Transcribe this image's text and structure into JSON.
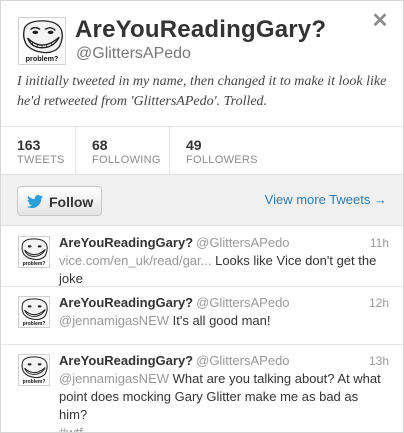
{
  "profile": {
    "name": "AreYouReadingGary?",
    "handle": "@GlittersAPedo",
    "bio": "I initially tweeted in my name, then changed it to make it look like he'd retweeted from 'GlittersAPedo'. Trolled.",
    "avatar_caption": "problem?",
    "close_icon": "close-icon"
  },
  "stats": [
    {
      "value": "163",
      "label": "TWEETS"
    },
    {
      "value": "68",
      "label": "FOLLOWING"
    },
    {
      "value": "49",
      "label": "FOLLOWERS"
    }
  ],
  "actions": {
    "follow_label": "Follow",
    "more_tweets_label": "View more Tweets →"
  },
  "tweets": [
    {
      "name": "AreYouReadingGary?",
      "handle": "@GlittersAPedo",
      "time": "11h",
      "link": "vice.com/en_uk/read/gar...",
      "text": " Looks like Vice don't get the joke"
    },
    {
      "name": "AreYouReadingGary?",
      "handle": "@GlittersAPedo",
      "time": "12h",
      "mention": "@jennamigasNEW",
      "text": " It's all good man!"
    },
    {
      "name": "AreYouReadingGary?",
      "handle": "@GlittersAPedo",
      "time": "13h",
      "mention": "@jennamigasNEW",
      "text": " What are you talking about? At what point does mocking Gary Glitter make me as bad as him?",
      "hashtag": "#wtf"
    }
  ],
  "colors": {
    "link_blue": "#2b7bb9",
    "muted_gray": "#999999",
    "bar_bg": "#f0f0f0"
  }
}
